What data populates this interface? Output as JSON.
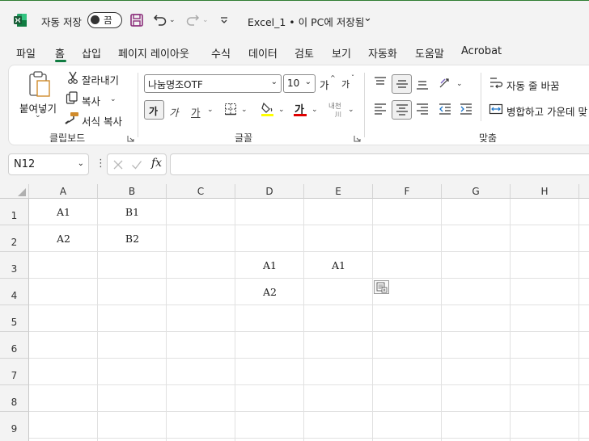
{
  "titlebar": {
    "autosave_label": "자동 저장",
    "autosave_state": "끔",
    "file_title": "Excel_1 • 이 PC에 저장됨",
    "title_chevron": "⌄"
  },
  "menu": {
    "tabs": [
      "파일",
      "홈",
      "삽입",
      "페이지 레이아웃",
      "수식",
      "데이터",
      "검토",
      "보기",
      "자동화",
      "도움말",
      "Acrobat"
    ],
    "active_tab": "홈"
  },
  "ribbon": {
    "clipboard": {
      "paste_label_1": "붙여넣기",
      "cut_label": "잘라내기",
      "copy_label": "복사",
      "format_painter_label": "서식 복사",
      "group_label": "클립보드"
    },
    "font": {
      "font_name": "나눔명조OTF",
      "font_size": "10",
      "bold_glyph": "가",
      "italic_glyph": "가",
      "underline_glyph": "가",
      "font_color_glyph": "가",
      "grow_glyph": "가",
      "shrink_glyph": "가",
      "phonetic_glyph": "내천",
      "group_label": "글꼴",
      "fill_color": "#ffff00",
      "font_color": "#e00000"
    },
    "alignment": {
      "wrap_label": "자동 줄 바꿈",
      "merge_label": "병합하고 가운데 맞",
      "group_label": "맞춤"
    }
  },
  "formula_bar": {
    "name_box": "N12",
    "fx_label": "fx",
    "formula": ""
  },
  "grid": {
    "columns": [
      "A",
      "B",
      "C",
      "D",
      "E",
      "F",
      "G",
      "H"
    ],
    "rows": [
      "1",
      "2",
      "3",
      "4",
      "5",
      "6",
      "7",
      "8",
      "9"
    ],
    "cells": {
      "A1": "A1",
      "B1": "B1",
      "A2": "A2",
      "B2": "B2",
      "D3": "A1",
      "E3": "A1",
      "D4": "A2"
    }
  },
  "colors": {
    "excel_green": "#107c41",
    "chrome_bg": "#f3f3f3"
  }
}
